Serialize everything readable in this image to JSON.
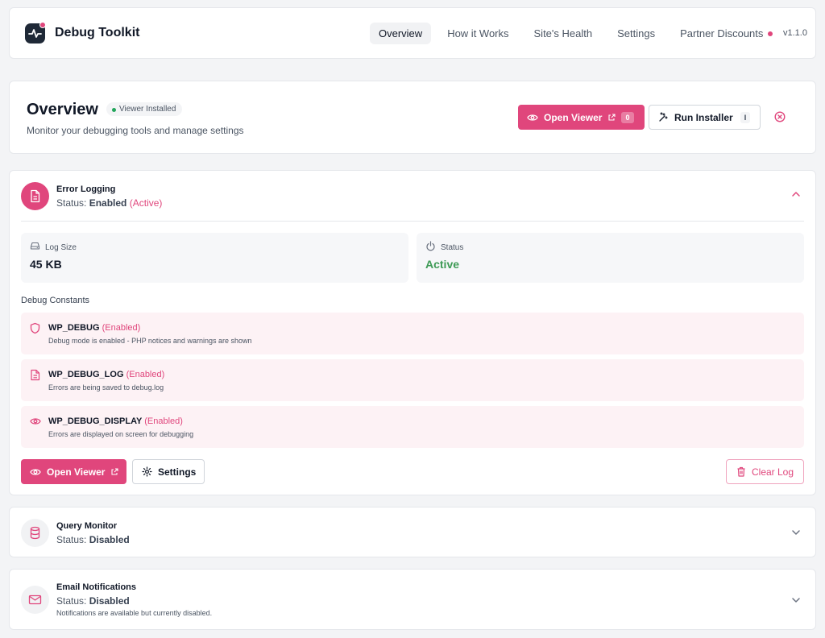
{
  "header": {
    "brand": "Debug Toolkit",
    "nav": [
      {
        "label": "Overview",
        "active": true
      },
      {
        "label": "How it Works"
      },
      {
        "label": "Site's Health"
      },
      {
        "label": "Settings"
      },
      {
        "label": "Partner Discounts",
        "dot": true
      }
    ],
    "version": "v1.1.0"
  },
  "overview": {
    "title": "Overview",
    "badge": "Viewer Installed",
    "subtitle": "Monitor your debugging tools and manage settings",
    "open_viewer_label": "Open Viewer",
    "open_viewer_count": "0",
    "run_installer_label": "Run Installer",
    "run_installer_kbd": "I"
  },
  "error_logging": {
    "title": "Error Logging",
    "status_prefix": "Status:",
    "status_value": "Enabled",
    "status_extra": "(Active)",
    "log_size_label": "Log Size",
    "log_size_value": "45 KB",
    "status_label": "Status",
    "status_box_value": "Active",
    "constants_title": "Debug Constants",
    "constants": [
      {
        "name": "WP_DEBUG",
        "state": "(Enabled)",
        "desc": "Debug mode is enabled - PHP notices and warnings are shown"
      },
      {
        "name": "WP_DEBUG_LOG",
        "state": "(Enabled)",
        "desc": "Errors are being saved to debug.log"
      },
      {
        "name": "WP_DEBUG_DISPLAY",
        "state": "(Enabled)",
        "desc": "Errors are displayed on screen for debugging"
      }
    ],
    "open_viewer_label": "Open Viewer",
    "settings_label": "Settings",
    "clear_log_label": "Clear Log"
  },
  "query_monitor": {
    "title": "Query Monitor",
    "status_prefix": "Status:",
    "status_value": "Disabled"
  },
  "email_notifications": {
    "title": "Email Notifications",
    "status_prefix": "Status:",
    "status_value": "Disabled",
    "note": "Notifications are available but currently disabled."
  },
  "colors": {
    "accent": "#e0467c",
    "success": "#3d9a55"
  }
}
